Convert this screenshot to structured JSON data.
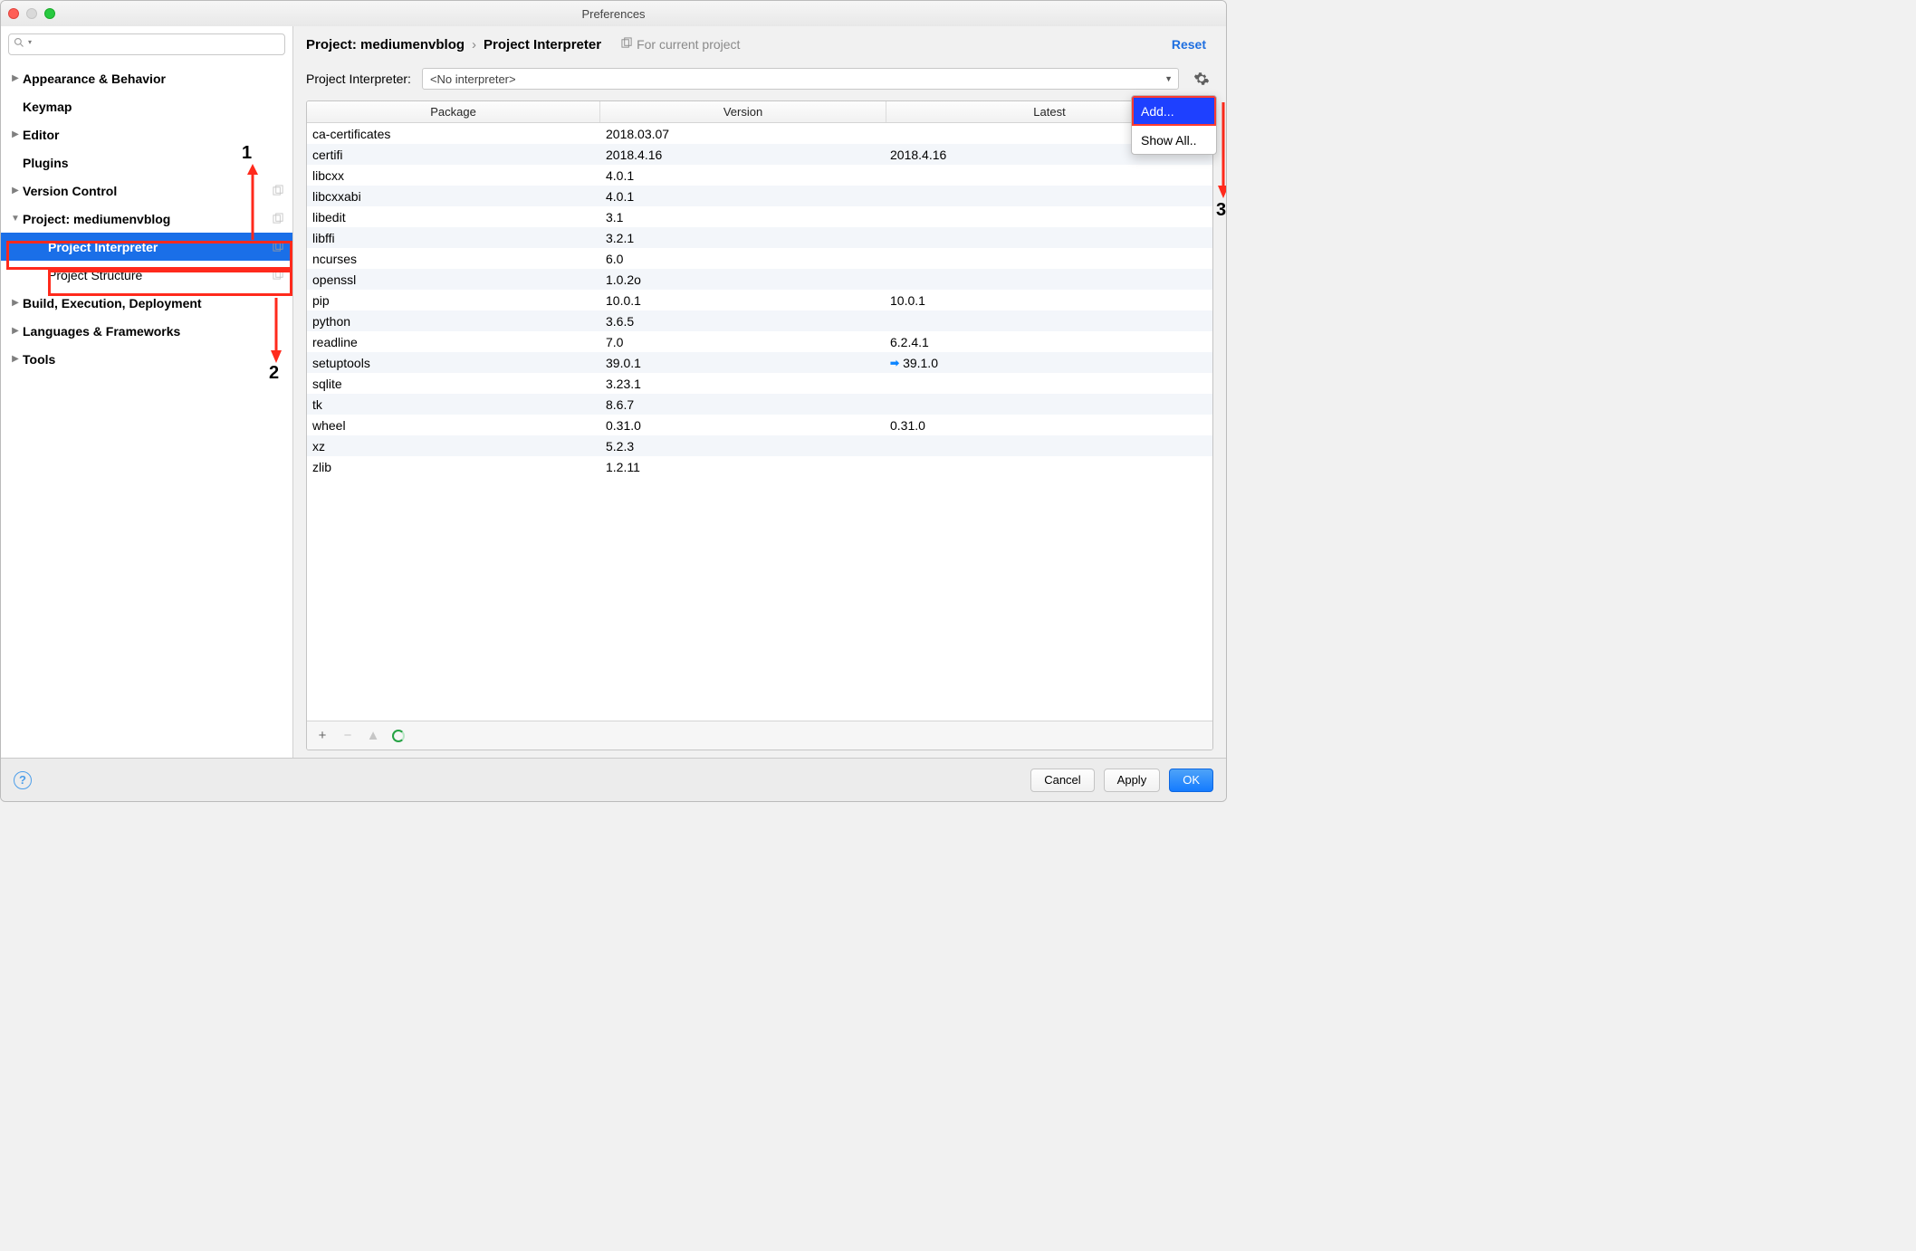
{
  "window": {
    "title": "Preferences"
  },
  "search": {
    "placeholder": ""
  },
  "sidebar": {
    "items": [
      {
        "label": "Appearance & Behavior",
        "expandable": true,
        "expanded": false,
        "bold": true
      },
      {
        "label": "Keymap",
        "expandable": false,
        "bold": true
      },
      {
        "label": "Editor",
        "expandable": true,
        "expanded": false,
        "bold": true
      },
      {
        "label": "Plugins",
        "expandable": false,
        "bold": true
      },
      {
        "label": "Version Control",
        "expandable": true,
        "expanded": false,
        "bold": true,
        "projIcon": true
      },
      {
        "label": "Project: mediumenvblog",
        "expandable": true,
        "expanded": true,
        "bold": true,
        "projIcon": true,
        "highlight": true
      },
      {
        "label": "Project Interpreter",
        "expandable": false,
        "bold": true,
        "child": true,
        "selected": true,
        "projIcon": true
      },
      {
        "label": "Project Structure",
        "expandable": false,
        "bold": false,
        "child": true,
        "projIcon": true
      },
      {
        "label": "Build, Execution, Deployment",
        "expandable": true,
        "expanded": false,
        "bold": true
      },
      {
        "label": "Languages & Frameworks",
        "expandable": true,
        "expanded": false,
        "bold": true
      },
      {
        "label": "Tools",
        "expandable": true,
        "expanded": false,
        "bold": true
      }
    ]
  },
  "breadcrumb": {
    "project_label": "Project: mediumenvblog",
    "sep": "›",
    "page": "Project Interpreter",
    "for_current": "For current project",
    "reset": "Reset"
  },
  "interpreter": {
    "label": "Project Interpreter:",
    "value": "<No interpreter>"
  },
  "gear_menu": {
    "items": [
      {
        "label": "Add...",
        "selected": true
      },
      {
        "label": "Show All..",
        "selected": false
      }
    ]
  },
  "table": {
    "headers": {
      "package": "Package",
      "version": "Version",
      "latest": "Latest"
    },
    "rows": [
      {
        "p": "ca-certificates",
        "v": "2018.03.07",
        "l": ""
      },
      {
        "p": "certifi",
        "v": "2018.4.16",
        "l": "2018.4.16"
      },
      {
        "p": "libcxx",
        "v": "4.0.1",
        "l": ""
      },
      {
        "p": "libcxxabi",
        "v": "4.0.1",
        "l": ""
      },
      {
        "p": "libedit",
        "v": "3.1",
        "l": ""
      },
      {
        "p": "libffi",
        "v": "3.2.1",
        "l": ""
      },
      {
        "p": "ncurses",
        "v": "6.0",
        "l": ""
      },
      {
        "p": "openssl",
        "v": "1.0.2o",
        "l": ""
      },
      {
        "p": "pip",
        "v": "10.0.1",
        "l": "10.0.1"
      },
      {
        "p": "python",
        "v": "3.6.5",
        "l": ""
      },
      {
        "p": "readline",
        "v": "7.0",
        "l": "6.2.4.1"
      },
      {
        "p": "setuptools",
        "v": "39.0.1",
        "l": "39.1.0",
        "update": true
      },
      {
        "p": "sqlite",
        "v": "3.23.1",
        "l": ""
      },
      {
        "p": "tk",
        "v": "8.6.7",
        "l": ""
      },
      {
        "p": "wheel",
        "v": "0.31.0",
        "l": "0.31.0"
      },
      {
        "p": "xz",
        "v": "5.2.3",
        "l": ""
      },
      {
        "p": "zlib",
        "v": "1.2.11",
        "l": ""
      }
    ]
  },
  "footer": {
    "cancel": "Cancel",
    "apply": "Apply",
    "ok": "OK"
  },
  "annotations": {
    "n1": "1",
    "n2": "2",
    "n3": "3"
  }
}
